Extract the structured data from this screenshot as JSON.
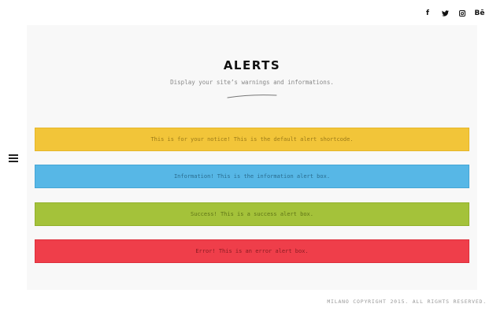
{
  "social": {
    "items": [
      {
        "name": "facebook-icon",
        "glyph": "f"
      },
      {
        "name": "twitter-icon",
        "glyph": ""
      },
      {
        "name": "instagram-icon",
        "glyph": ""
      },
      {
        "name": "behance-icon",
        "glyph": "Bē"
      }
    ]
  },
  "header": {
    "title": "ALERTS",
    "subtitle": "Display your site’s warnings and informations."
  },
  "alerts": {
    "notice": "This is for your notice! This is the default alert shortcode.",
    "info": "Information! This is the information alert box.",
    "success": "Success! This is a success alert box.",
    "error": "Error! This is an error alert box."
  },
  "colors": {
    "notice": "#f2c539",
    "info": "#57b7e6",
    "success": "#a4c23a",
    "error": "#ef3e4a",
    "panel": "#f8f8f8"
  },
  "footer": {
    "copyright": "MILANO COPYRIGHT 2015. ALL RIGHTS RESERVED."
  }
}
